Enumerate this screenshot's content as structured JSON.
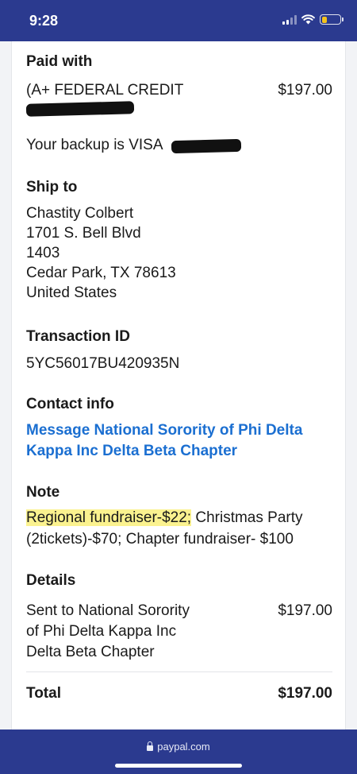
{
  "status_bar": {
    "time": "9:28"
  },
  "paid_with": {
    "heading": "Paid with",
    "method": "(A+ FEDERAL CREDIT",
    "amount": "$197.00",
    "backup_prefix": "Your backup is VISA"
  },
  "ship_to": {
    "heading": "Ship to",
    "name": "Chastity Colbert",
    "line1": "1701 S. Bell Blvd",
    "line2": "1403",
    "city_line": "Cedar Park, TX 78613",
    "country": "United States"
  },
  "transaction": {
    "heading": "Transaction ID",
    "id": "5YC56017BU420935N"
  },
  "contact": {
    "heading": "Contact info",
    "link_line1": "Message National Sorority of Phi Delta",
    "link_line2": "Kappa Inc Delta Beta Chapter"
  },
  "note": {
    "heading": "Note",
    "highlighted": "Regional fundraiser-$22;",
    "rest_line1": " Christmas Party",
    "line2": "(2tickets)-$70; Chapter fundraiser- $100"
  },
  "details": {
    "heading": "Details",
    "sent_line1": "Sent to National Sorority",
    "sent_line2": "of Phi Delta Kappa Inc",
    "sent_line3": "Delta Beta Chapter",
    "amount": "$197.00"
  },
  "total": {
    "label": "Total",
    "amount": "$197.00"
  },
  "browser": {
    "url": "paypal.com"
  },
  "colors": {
    "brand": "#2b3a8f",
    "link": "#1b6fd1",
    "highlight": "#fbf28f"
  }
}
